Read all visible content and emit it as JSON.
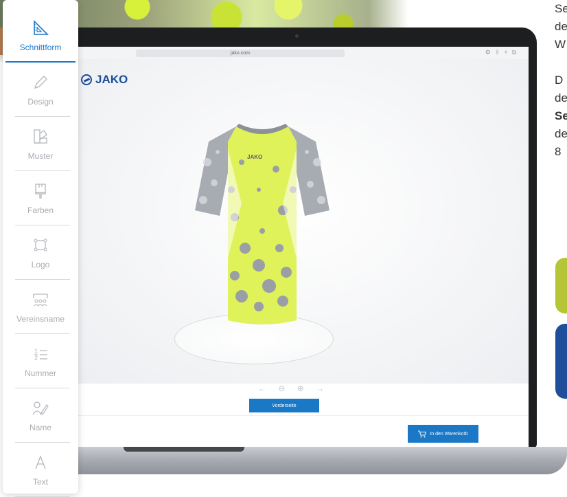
{
  "browser": {
    "url": "jako.com"
  },
  "brand": {
    "name": "JAKO"
  },
  "shirt": {
    "chest_text": "JAKO"
  },
  "buttons": {
    "view": "Vorderseite",
    "cart": "In den Warenkorb"
  },
  "view_controls": {
    "glyphs": "← ⊖ ⊕ →"
  },
  "sidebar": {
    "items": [
      {
        "label": "Schnittform",
        "icon": "set-square-icon",
        "active": true
      },
      {
        "label": "Design",
        "icon": "pencil-icon",
        "active": false
      },
      {
        "label": "Muster",
        "icon": "swatch-icon",
        "active": false
      },
      {
        "label": "Farben",
        "icon": "paint-brush-icon",
        "active": false
      },
      {
        "label": "Logo",
        "icon": "logo-frame-icon",
        "active": false
      },
      {
        "label": "Vereinsname",
        "icon": "team-name-icon",
        "active": false
      },
      {
        "label": "Nummer",
        "icon": "number-list-icon",
        "active": false
      },
      {
        "label": "Name",
        "icon": "person-pen-icon",
        "active": false
      },
      {
        "label": "Text",
        "icon": "text-icon",
        "active": false
      }
    ]
  },
  "side_text": {
    "lines": [
      "Se",
      "de",
      "W",
      "",
      "D",
      "de",
      "Se",
      "de",
      "8"
    ],
    "bold_line_index": 6
  },
  "colors": {
    "accent_blue": "#1a78c7",
    "brand_blue": "#1b4d9b",
    "card_green": "#b5c535",
    "card_blue": "#1f4f9b",
    "shirt_yellow": "#dff25a",
    "shirt_gray": "#9a9ea5"
  }
}
